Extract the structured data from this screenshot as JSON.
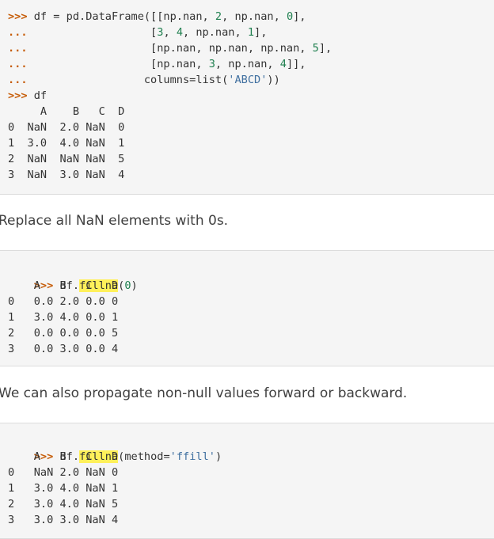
{
  "block1": {
    "prompt_main": ">>>",
    "prompt_cont": "...",
    "lines": [
      {
        "prompt": ">>>",
        "segments": [
          {
            "t": " df = pd.DataFrame([[np.nan, ",
            "c": "kw"
          },
          {
            "t": "2",
            "c": "num"
          },
          {
            "t": ", np.nan, ",
            "c": "kw"
          },
          {
            "t": "0",
            "c": "num"
          },
          {
            "t": "],",
            "c": "kw"
          }
        ]
      },
      {
        "prompt": "...",
        "segments": [
          {
            "t": "                   [",
            "c": "kw"
          },
          {
            "t": "3",
            "c": "num"
          },
          {
            "t": ", ",
            "c": "kw"
          },
          {
            "t": "4",
            "c": "num"
          },
          {
            "t": ", np.nan, ",
            "c": "kw"
          },
          {
            "t": "1",
            "c": "num"
          },
          {
            "t": "],",
            "c": "kw"
          }
        ]
      },
      {
        "prompt": "...",
        "segments": [
          {
            "t": "                   [np.nan, np.nan, np.nan, ",
            "c": "kw"
          },
          {
            "t": "5",
            "c": "num"
          },
          {
            "t": "],",
            "c": "kw"
          }
        ]
      },
      {
        "prompt": "...",
        "segments": [
          {
            "t": "                   [np.nan, ",
            "c": "kw"
          },
          {
            "t": "3",
            "c": "num"
          },
          {
            "t": ", np.nan, ",
            "c": "kw"
          },
          {
            "t": "4",
            "c": "num"
          },
          {
            "t": "]],",
            "c": "kw"
          }
        ]
      },
      {
        "prompt": "...",
        "segments": [
          {
            "t": "                  columns=list(",
            "c": "kw"
          },
          {
            "t": "'ABCD'",
            "c": "str"
          },
          {
            "t": "))",
            "c": "kw"
          }
        ]
      },
      {
        "prompt": ">>>",
        "segments": [
          {
            "t": " df",
            "c": "kw"
          }
        ]
      }
    ],
    "output": [
      "     A    B   C  D",
      "0  NaN  2.0 NaN  0",
      "1  3.0  4.0 NaN  1",
      "2  NaN  NaN NaN  5",
      "3  NaN  3.0 NaN  4"
    ]
  },
  "prose1": "Replace all NaN elements with 0s.",
  "block2": {
    "prompt": ">>>",
    "call_prefix": " df.",
    "call_method": "fillna",
    "call_open": "(",
    "call_arg": "0",
    "call_close": ")",
    "output": [
      "    A   B   C   D",
      "0   0.0 2.0 0.0 0",
      "1   3.0 4.0 0.0 1",
      "2   0.0 0.0 0.0 5",
      "3   0.0 3.0 0.0 4"
    ]
  },
  "prose2": "We can also propagate non-null values forward or backward.",
  "block3": {
    "prompt": ">>>",
    "call_prefix": " df.",
    "call_method": "fillna",
    "call_open": "(method=",
    "call_arg": "'ffill'",
    "call_close": ")",
    "output": [
      "    A   B   C   D",
      "0   NaN 2.0 NaN 0",
      "1   3.0 4.0 NaN 1",
      "2   3.0 4.0 NaN 5",
      "3   3.0 3.0 NaN 4"
    ]
  }
}
